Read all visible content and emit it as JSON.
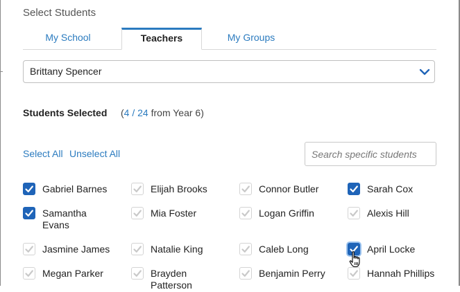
{
  "dialog": {
    "title": "Select Students"
  },
  "tabs": [
    {
      "label": "My School",
      "active": false
    },
    {
      "label": "Teachers",
      "active": true
    },
    {
      "label": "My Groups",
      "active": false
    }
  ],
  "teacher_select": {
    "value": "Brittany Spencer",
    "icon": "chevron-down-icon"
  },
  "selection": {
    "title": "Students Selected",
    "open_paren": "(",
    "selected": "4",
    "separator": " / ",
    "total": "24",
    "suffix": " from Year 6)"
  },
  "actions": {
    "select_all": "Select All",
    "unselect_all": "Unselect All"
  },
  "search": {
    "placeholder": "Search specific students",
    "value": ""
  },
  "colors": {
    "accent": "#2b7bbf",
    "checkbox_checked": "#1f64b8"
  },
  "students": [
    {
      "name": "Gabriel Barnes",
      "checked": true
    },
    {
      "name": "Elijah Brooks",
      "checked": false
    },
    {
      "name": "Connor Butler",
      "checked": false
    },
    {
      "name": "Sarah Cox",
      "checked": true
    },
    {
      "name": "Samantha Evans",
      "checked": true
    },
    {
      "name": "Mia Foster",
      "checked": false
    },
    {
      "name": "Logan Griffin",
      "checked": false
    },
    {
      "name": "Alexis Hill",
      "checked": false
    },
    {
      "name": "Jasmine James",
      "checked": false
    },
    {
      "name": "Natalie King",
      "checked": false
    },
    {
      "name": "Caleb Long",
      "checked": false
    },
    {
      "name": "April Locke",
      "checked": true
    },
    {
      "name": "Megan Parker",
      "checked": false
    },
    {
      "name": "Brayden Patterson",
      "checked": false
    },
    {
      "name": "Benjamin Perry",
      "checked": false
    },
    {
      "name": "Hannah Phillips",
      "checked": false
    }
  ]
}
